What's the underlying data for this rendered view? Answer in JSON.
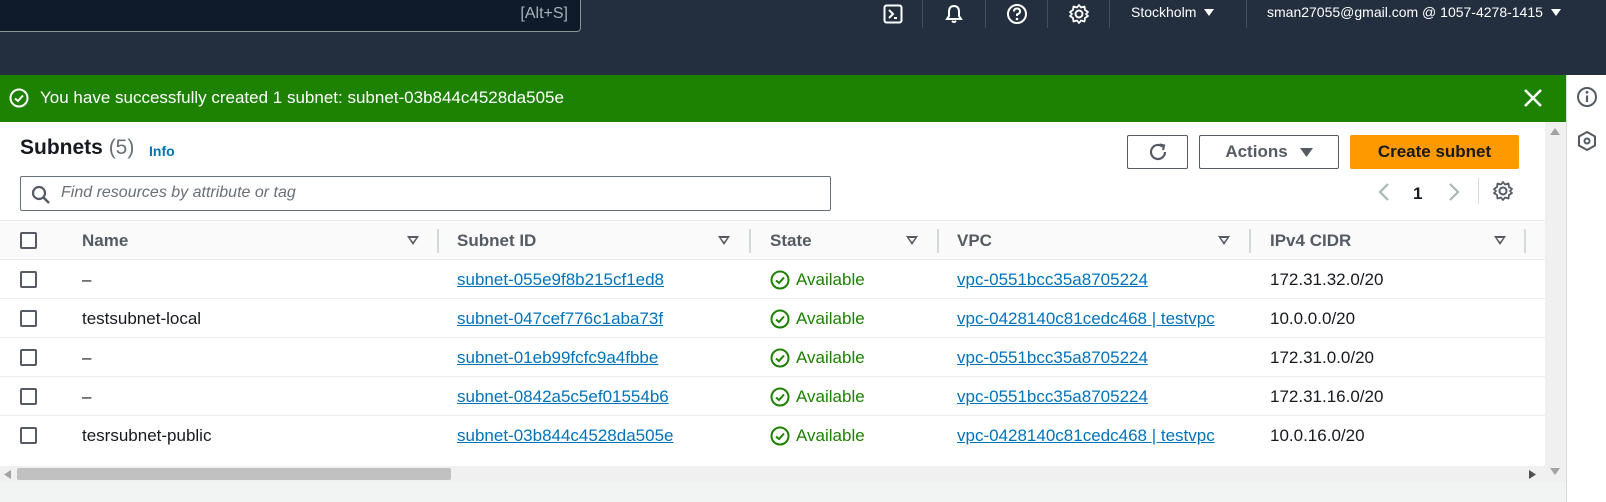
{
  "topbar": {
    "search_shortcut": "[Alt+S]",
    "region": "Stockholm",
    "account": "sman27055@gmail.com @ 1057-4278-1415"
  },
  "flash": {
    "message": "You have successfully created 1 subnet: subnet-03b844c4528da505e"
  },
  "panel": {
    "title": "Subnets",
    "count": "(5)",
    "info": "Info",
    "actions_label": "Actions",
    "create_label": "Create subnet",
    "filter_placeholder": "Find resources by attribute or tag",
    "page": "1"
  },
  "table": {
    "columns": [
      "Name",
      "Subnet ID",
      "State",
      "VPC",
      "IPv4 CIDR"
    ],
    "rows": [
      {
        "name": "–",
        "subnet_id": "subnet-055e9f8b215cf1ed8",
        "state": "Available",
        "vpc": "vpc-0551bcc35a8705224",
        "cidr": "172.31.32.0/20"
      },
      {
        "name": "testsubnet-local",
        "subnet_id": "subnet-047cef776c1aba73f",
        "state": "Available",
        "vpc": "vpc-0428140c81cedc468 | testvpc",
        "cidr": "10.0.0.0/20"
      },
      {
        "name": "–",
        "subnet_id": "subnet-01eb99fcfc9a4fbbe",
        "state": "Available",
        "vpc": "vpc-0551bcc35a8705224",
        "cidr": "172.31.0.0/20"
      },
      {
        "name": "–",
        "subnet_id": "subnet-0842a5c5ef01554b6",
        "state": "Available",
        "vpc": "vpc-0551bcc35a8705224",
        "cidr": "172.31.16.0/20"
      },
      {
        "name": "tesrsubnet-public",
        "subnet_id": "subnet-03b844c4528da505e",
        "state": "Available",
        "vpc": "vpc-0428140c81cedc468 | testvpc",
        "cidr": "10.0.16.0/20"
      }
    ]
  },
  "colors": {
    "nav_bg": "#232f3e",
    "success": "#1d8102",
    "link": "#0073bb",
    "primary_button": "#ff9900"
  },
  "icons": [
    "cloudshell-icon",
    "bell-icon",
    "help-icon",
    "gear-icon",
    "success-check-icon",
    "close-icon",
    "info-icon",
    "hexagon-icon",
    "refresh-icon",
    "search-icon"
  ]
}
